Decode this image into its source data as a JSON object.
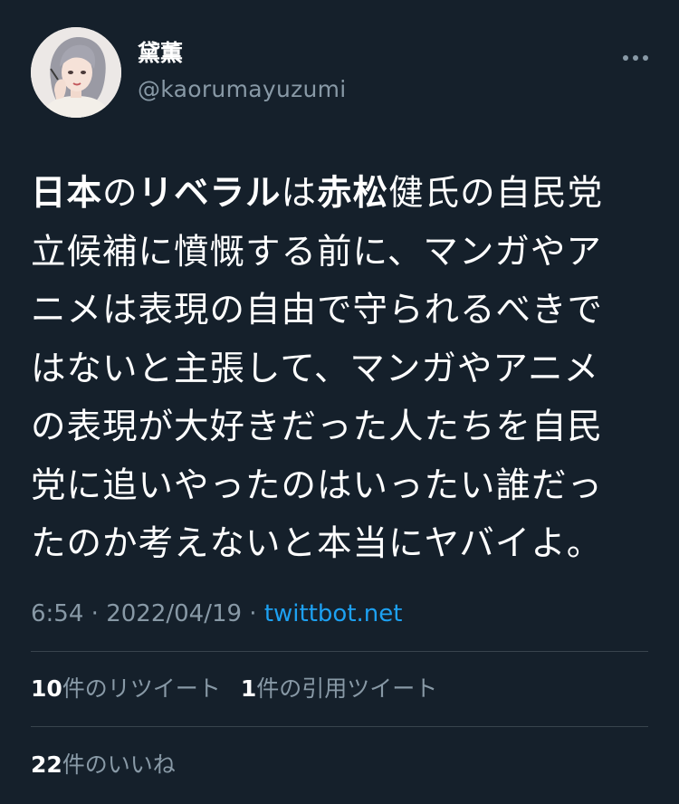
{
  "author": {
    "display_name": "黛薫",
    "handle": "@kaorumayuzumi"
  },
  "tweet": {
    "segments": [
      {
        "text": "日本",
        "bold": true
      },
      {
        "text": "の",
        "bold": false
      },
      {
        "text": "リベラル",
        "bold": true
      },
      {
        "text": "は",
        "bold": false
      },
      {
        "text": "赤松",
        "bold": true
      },
      {
        "text": "健氏の自民党\n立候補に憤慨する前に、マンガやア\nニメは表現の自由で守られるべきで\nはないと主張して、マンガやアニメ\nの表現が大好きだった人たちを自民\n党に追いやったのはいったい誰だっ\nたのか考えないと本当にヤバイよ。",
        "bold": false
      }
    ]
  },
  "meta": {
    "time": "6:54",
    "separator1": " · ",
    "date": "2022/04/19",
    "separator2": " · ",
    "source": "twittbot.net"
  },
  "stats": {
    "retweets_count": "10",
    "retweets_label": "件のリツイート",
    "quotes_count": "1",
    "quotes_label": "件の引用ツイート",
    "likes_count": "22",
    "likes_label": "件のいいね"
  },
  "colors": {
    "background": "#15202b",
    "secondary_text": "#8899a6",
    "link": "#1da1f2",
    "divider": "#38444d"
  }
}
